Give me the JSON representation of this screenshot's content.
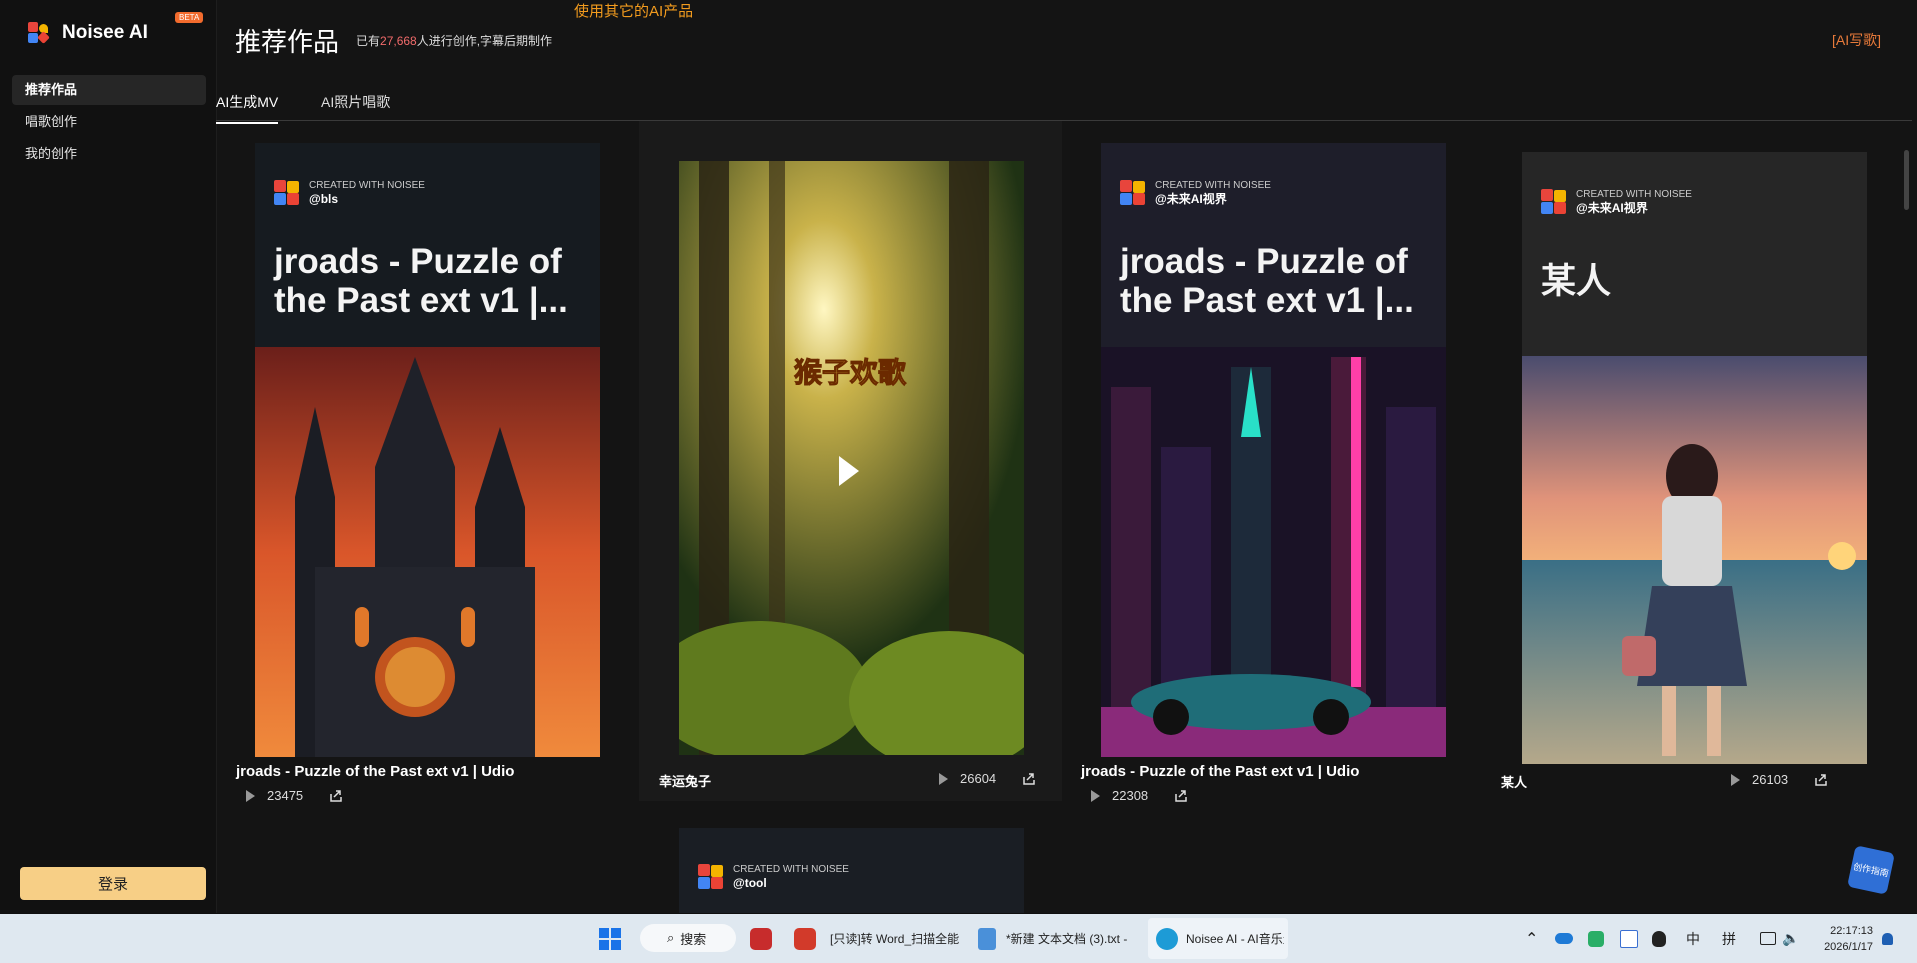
{
  "sidebar": {
    "brand": "Noisee AI",
    "beta": "BETA",
    "items": [
      {
        "label": "推荐作品"
      },
      {
        "label": "唱歌创作"
      },
      {
        "label": "我的创作"
      }
    ],
    "login_label": "登录"
  },
  "header": {
    "title": "推荐作品",
    "stats_prefix": "已有",
    "stats_count": "27,668",
    "stats_suffix": "人进行创作,字幕后期制作",
    "promo": "使用其它的AI产品",
    "ai_link": "[AI写歌]"
  },
  "tabs": [
    {
      "label": "AI生成MV"
    },
    {
      "label": "AI照片唱歌"
    }
  ],
  "cards": [
    {
      "badge": "CREATED WITH NOISEE",
      "author": "@bls",
      "headline": "jroads - Puzzle of the Past ext v1 |...",
      "title": "jroads - Puzzle of the Past ext v1 | Udio",
      "plays": "23475"
    },
    {
      "overlay_text": "猴子欢歌",
      "title": "幸运兔子",
      "plays": "26604"
    },
    {
      "badge": "CREATED WITH NOISEE",
      "author": "@未来AI视界",
      "headline": "jroads - Puzzle of the Past ext v1 |...",
      "title": "jroads - Puzzle of the Past ext v1 | Udio",
      "plays": "22308"
    },
    {
      "badge": "CREATED WITH NOISEE",
      "author": "@未来AI视界",
      "headline": "某人",
      "title": "某人",
      "plays": "26103"
    },
    {
      "badge": "CREATED WITH NOISEE",
      "author": "@tool"
    }
  ],
  "floating_badge": "创作指南",
  "taskbar": {
    "search": "搜索",
    "apps": [
      {
        "label": "[只读]转 Word_扫描全能"
      },
      {
        "label": "*新建 文本文档 (3).txt - "
      },
      {
        "label": "Noisee AI - AI音乐生成器"
      }
    ],
    "ime_1": "中",
    "ime_2": "拼",
    "time": "22:17:13",
    "date": "2026/1/17"
  },
  "colors": {
    "accent_orange": "#f29b1e",
    "login_bg": "#f7cf86",
    "stat_count": "#f26b6b"
  }
}
